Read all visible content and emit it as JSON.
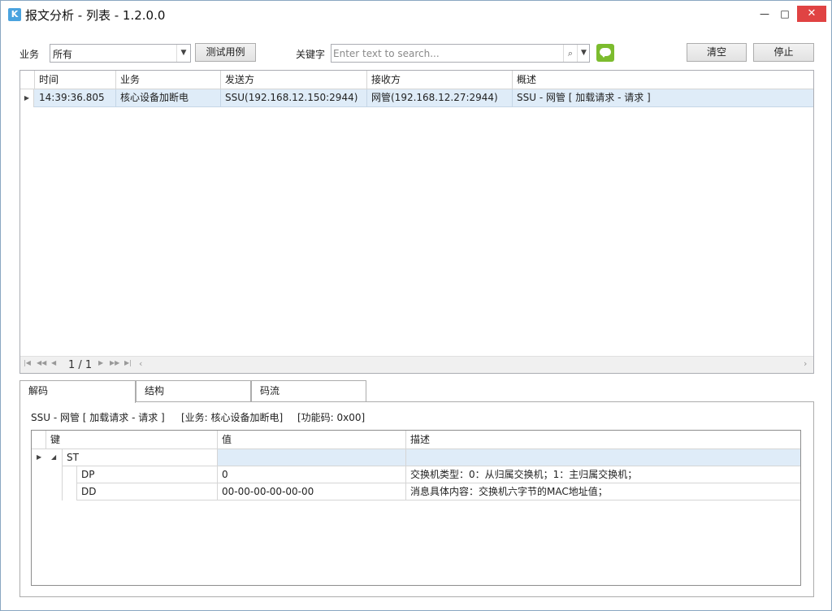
{
  "window": {
    "title": "报文分析 - 列表 - 1.2.0.0",
    "minimize": "—",
    "maximize": "□",
    "close": "✕"
  },
  "toolbar": {
    "business_label": "业务",
    "business_value": "所有",
    "test_button": "测试用例",
    "keyword_label": "关键字",
    "search_placeholder": "Enter text to search...",
    "clear_button": "清空",
    "stop_button": "停止"
  },
  "list": {
    "columns": [
      "时间",
      "业务",
      "发送方",
      "接收方",
      "概述"
    ],
    "rows": [
      {
        "time": "14:39:36.805",
        "business": "核心设备加断电",
        "sender": "SSU(192.168.12.150:2944)",
        "receiver": "网管(192.168.12.27:2944)",
        "summary": "SSU - 网管 [ 加载请求 - 请求 ]"
      }
    ],
    "pager": "1 / 1"
  },
  "tabs": [
    "解码",
    "结构",
    "码流"
  ],
  "decode": {
    "summary": "SSU - 网管 [ 加载请求 - 请求 ]",
    "business": "[业务: 核心设备加断电]",
    "function_code": "[功能码: 0x00]",
    "columns": [
      "键",
      "值",
      "描述"
    ],
    "rows": [
      {
        "key": "ST",
        "value": "",
        "desc": ""
      },
      {
        "key": "DP",
        "value": "0",
        "desc": "交换机类型：0：从归属交换机；1：主归属交换机；"
      },
      {
        "key": "DD",
        "value": "00-00-00-00-00-00",
        "desc": "消息具体内容：交换机六字节的MAC地址值；"
      }
    ]
  }
}
